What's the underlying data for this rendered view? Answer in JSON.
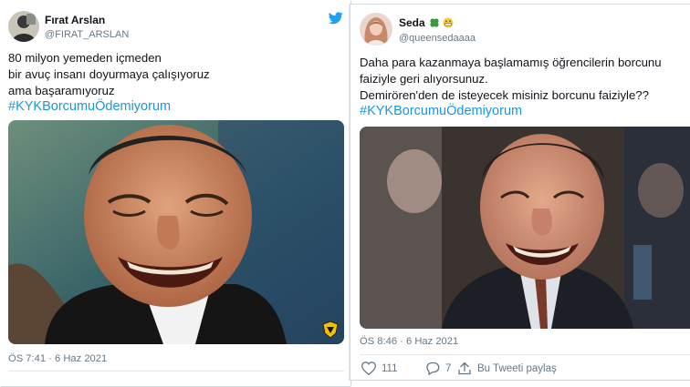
{
  "left_tweet": {
    "display_name": "Fırat Arslan",
    "handle": "@FIRAT_ARSLAN",
    "lines": [
      "80 milyon yemeden içmeden",
      "bir avuç insanı doyurmaya çalışıyoruz",
      "ama başaramıyoruz"
    ],
    "hashtag": "#KYKBorcumuÖdemiyorum",
    "timestamp": "ÖS 7:41 · 6 Haz 2021",
    "icons": {
      "brand": "twitter-bird-icon",
      "watermark": "club-crest-icon"
    },
    "brand_color": "#1da1f2"
  },
  "right_tweet": {
    "display_name": "Seda",
    "name_emojis": [
      "four-leaf-clover-icon",
      "grimacing-face-icon"
    ],
    "handle": "@queensedaaaa",
    "lines": [
      "Daha para kazanmaya başlamamış öğrencilerin borcunu",
      "faiziyle geri alıyorsunuz.",
      "Demirören'den de isteyecek misiniz borcunu faiziyle??"
    ],
    "hashtag": "#KYKBorcumuÖdemiyorum",
    "timestamp": "ÖS 8:46 · 6 Haz 2021",
    "actions": {
      "likes": "111",
      "replies": "7",
      "share_label": "Bu Tweeti paylaş"
    }
  },
  "colors": {
    "hashtag": "#1b95e0",
    "muted": "#657786",
    "text": "#0f1419",
    "border": "#cfd9de"
  }
}
